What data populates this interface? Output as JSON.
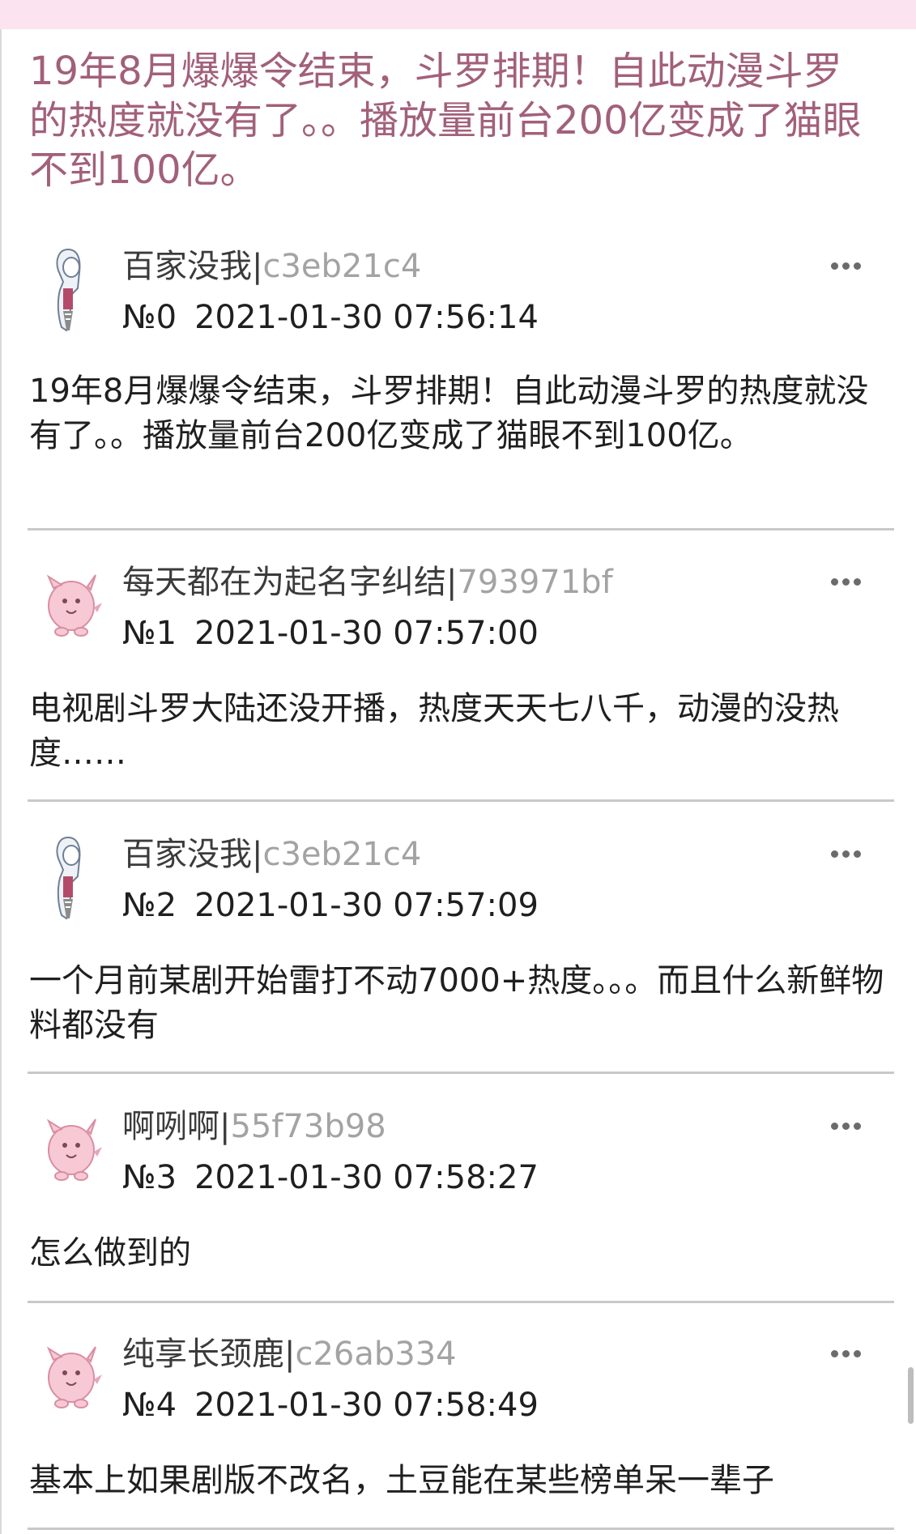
{
  "thread": {
    "title": "19年8月爆爆令结束，斗罗排期！自此动漫斗罗的热度就没有了。。播放量前台200亿变成了猫眼不到100亿。"
  },
  "posts": [
    {
      "name": "百家没我",
      "sep": "|",
      "uid": "c3eb21c4",
      "no": "№0",
      "time": "2021-01-30 07:56:14",
      "body": "19年8月爆爆令结束，斗罗排期！自此动漫斗罗的热度就没有了。。播放量前台200亿变成了猫眼不到100亿。",
      "avatar": "girl-avatar-icon"
    },
    {
      "name": "每天都在为起名字纠结",
      "sep": "|",
      "uid": "793971bf",
      "no": "№1",
      "time": "2021-01-30 07:57:00",
      "body": "电视剧斗罗大陆还没开播，热度天天七八千，动漫的没热度……",
      "avatar": "pink-creature-avatar-icon"
    },
    {
      "name": "百家没我",
      "sep": "|",
      "uid": "c3eb21c4",
      "no": "№2",
      "time": "2021-01-30 07:57:09",
      "body": "一个月前某剧开始雷打不动7000+热度。。。而且什么新鲜物料都没有",
      "avatar": "girl-avatar-icon"
    },
    {
      "name": "啊咧啊",
      "sep": "|",
      "uid": "55f73b98",
      "no": "№3",
      "time": "2021-01-30 07:58:27",
      "body": "怎么做到的",
      "avatar": "pink-creature-avatar-icon"
    },
    {
      "name": "纯享长颈鹿",
      "sep": "|",
      "uid": "c26ab334",
      "no": "№4",
      "time": "2021-01-30 07:58:49",
      "body": "基本上如果剧版不改名，土豆能在某些榜单呆一辈子",
      "avatar": "pink-creature-avatar-icon"
    }
  ],
  "colors": {
    "title": "#a2607a",
    "uid": "#a3a3a3",
    "topbar": "#fbe3ef"
  }
}
